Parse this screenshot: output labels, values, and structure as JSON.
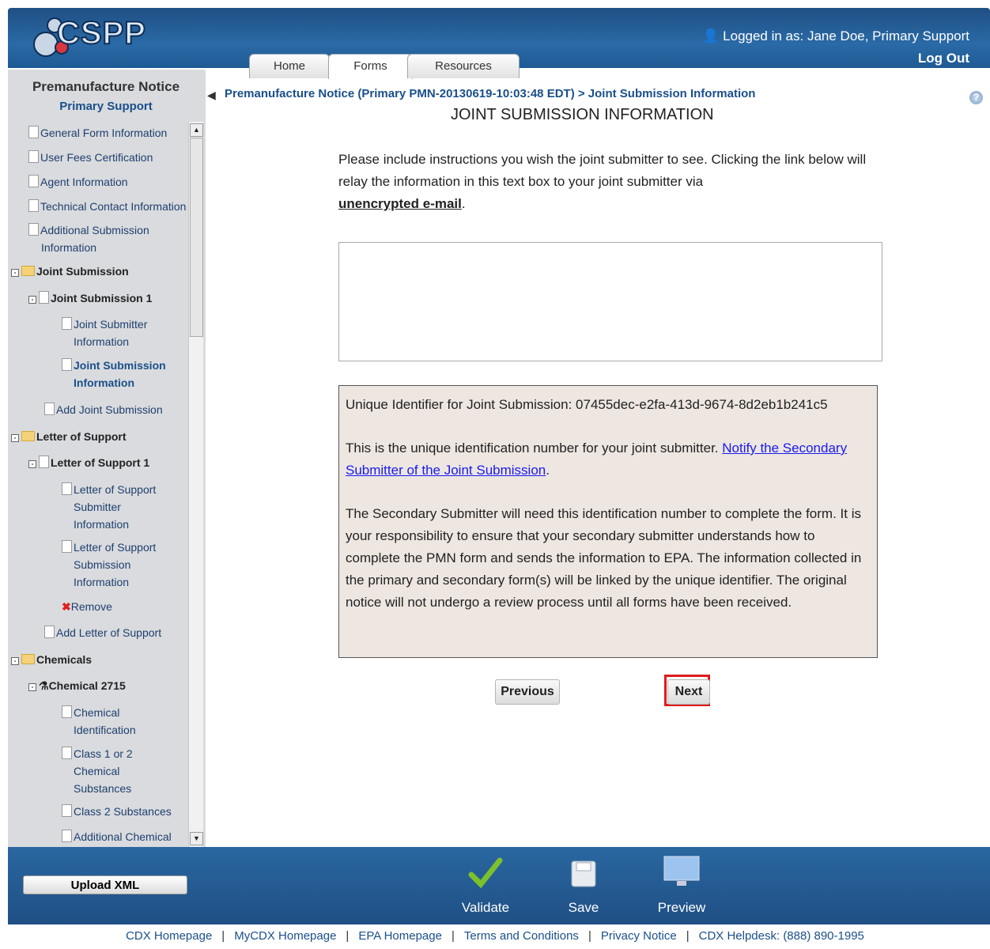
{
  "header": {
    "logo_text": "CSPP",
    "tabs": [
      "Home",
      "Forms",
      "Resources"
    ],
    "logged_in": "Logged in as: Jane Doe, Primary Support",
    "logout": "Log Out"
  },
  "sidebar": {
    "title": "Premanufacture Notice",
    "subtitle": "Primary Support",
    "items": [
      "General Form Information",
      "User Fees Certification",
      "Agent Information",
      "Technical Contact Information",
      "Additional Submission",
      "Information",
      "Joint Submission",
      "Joint Submission 1",
      "Joint Submitter",
      "Information",
      "Joint Submission",
      "Information",
      "Add Joint Submission",
      "Letter of Support",
      "Letter of Support 1",
      "Letter of Support",
      "Submitter",
      "Information",
      "Letter of Support",
      "Submission",
      "Information",
      "Remove",
      "Add Letter of Support",
      "Chemicals",
      "Chemical 2715",
      "Chemical",
      "Identification",
      "Class 1 or 2",
      "Chemical",
      "Substances",
      "Class 2 Substances",
      "Additional Chemical"
    ]
  },
  "main": {
    "breadcrumb": "Premanufacture Notice (Primary PMN-20130619-10:03:48 EDT) > Joint Submission Information",
    "title": "JOINT SUBMISSION INFORMATION",
    "instructions_1": "Please include instructions you wish the joint submitter to see. Clicking the link below will relay the information in this text box to your joint submitter via",
    "instructions_bold": "unencrypted e-mail",
    "instructions_end": ".",
    "textarea_value": "",
    "info_line1": "Unique Identifier for Joint Submission: 07455dec-e2fa-413d-9674-8d2eb1b241c5",
    "info_p2_text": "This is the unique identification number for your joint submitter.",
    "info_p2_link": "Notify the Secondary Submitter of the Joint Submission",
    "info_p2_end": ".",
    "info_p3": "The Secondary Submitter will need this identification number to complete the form. It is your responsibility to ensure that your secondary submitter understands how to complete the PMN form and sends the information to EPA. The information collected in the primary and secondary form(s) will be linked by the unique identifier. The original notice will not undergo a review process until all forms have been received.",
    "prev": "Previous",
    "next": "Next"
  },
  "toolbar": {
    "upload": "Upload XML",
    "validate": "Validate",
    "save": "Save",
    "preview": "Preview"
  },
  "footer": {
    "links": [
      "CDX Homepage",
      "MyCDX Homepage",
      "EPA Homepage",
      "Terms and Conditions",
      "Privacy Notice",
      "CDX Helpdesk: (888) 890-1995"
    ]
  }
}
